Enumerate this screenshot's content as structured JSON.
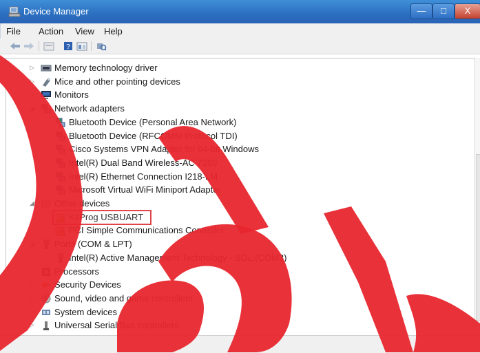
{
  "window": {
    "title": "Device Manager"
  },
  "window_buttons": {
    "minimize": "—",
    "maximize": "□",
    "close": "X"
  },
  "menu": [
    "File",
    "Action",
    "View",
    "Help"
  ],
  "toolbar_icons": [
    "back-arrow-icon",
    "forward-arrow-icon",
    "properties-icon",
    "help-icon",
    "details-view-icon",
    "scan-hardware-icon"
  ],
  "tree": [
    {
      "label": "Memory technology driver",
      "icon": "memory-icon",
      "expanded": false
    },
    {
      "label": "Mice and other pointing devices",
      "icon": "mouse-icon",
      "expanded": false
    },
    {
      "label": "Monitors",
      "icon": "monitor-icon",
      "expanded": false
    },
    {
      "label": "Network adapters",
      "icon": "network-icon",
      "expanded": true
    },
    {
      "label": "Bluetooth Device (Personal Area Network)",
      "icon": "network-icon"
    },
    {
      "label": "Bluetooth Device (RFCOMM Protocol TDI)",
      "icon": "network-icon"
    },
    {
      "label": "Cisco Systems VPN Adapter for 64-bit Windows",
      "icon": "network-icon"
    },
    {
      "label": "Intel(R) Dual Band Wireless-AC 7260",
      "icon": "network-icon"
    },
    {
      "label": "Intel(R) Ethernet Connection I218-LM",
      "icon": "network-icon"
    },
    {
      "label": "Microsoft Virtual WiFi Miniport Adapter",
      "icon": "network-icon"
    },
    {
      "label": "Other devices",
      "icon": "unknown-device-icon",
      "expanded": true
    },
    {
      "label": "KitProg USBUART",
      "icon": "warning-device-icon",
      "highlighted": true
    },
    {
      "label": "PCI Simple Communications Controller",
      "icon": "warning-device-icon"
    },
    {
      "label": "Ports (COM & LPT)",
      "icon": "port-icon",
      "expanded": true
    },
    {
      "label": "Intel(R) Active Management Technology - SOL (COM3)",
      "icon": "port-icon"
    },
    {
      "label": "Processors",
      "icon": "processor-icon",
      "expanded": false
    },
    {
      "label": "Security Devices",
      "icon": "security-icon",
      "expanded": false
    },
    {
      "label": "Sound, video and game controllers",
      "icon": "sound-icon",
      "expanded": false
    },
    {
      "label": "System devices",
      "icon": "system-icon",
      "expanded": false
    },
    {
      "label": "Universal Serial Bus controllers",
      "icon": "usb-icon",
      "expanded": false
    }
  ],
  "colors": {
    "titlebar": "#2b6fc0",
    "highlight_box": "#e0454a",
    "watermark": "#e8262e"
  }
}
